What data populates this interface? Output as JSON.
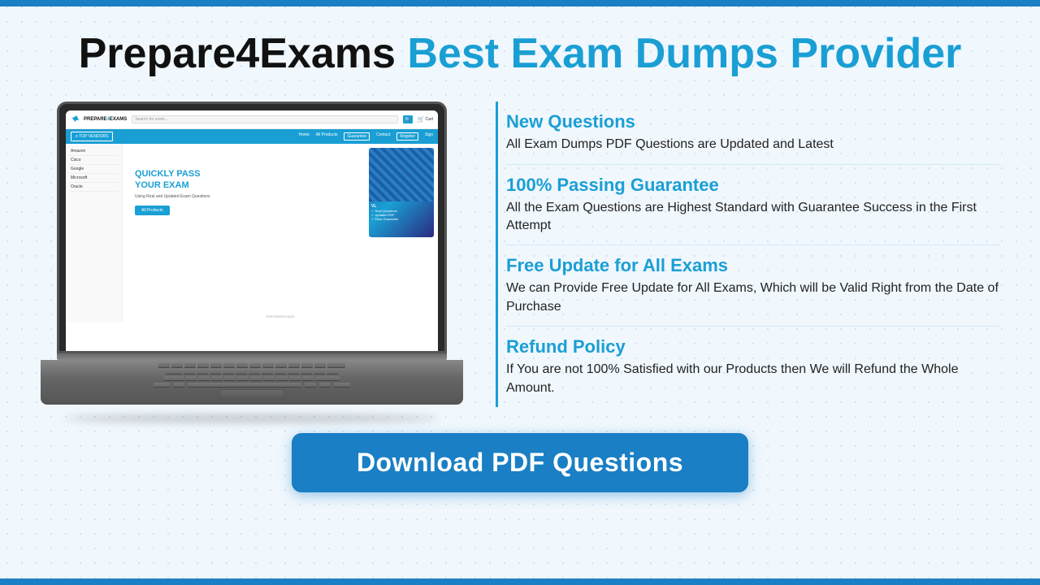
{
  "header": {
    "brand": "Prepare4Exams",
    "tagline": "Best Exam Dumps Provider"
  },
  "laptop": {
    "site": {
      "logo_text": "PREPARE",
      "logo_text2": "4EXAMS",
      "search_placeholder": "Search for exam...",
      "cart_label": "Cart",
      "nav_vendors": "≡  TOP VENDORS",
      "nav_links": [
        "Home",
        "All Products",
        "Guarantee",
        "Contact",
        "Register",
        "Sign"
      ],
      "sidebar_items": [
        "Amazon",
        "Cisco",
        "Google",
        "Microsoft",
        "Oracle"
      ],
      "hero_title": "QUICKLY PASS\nYOUR EXAM",
      "hero_subtitle": "Using Real and Updated Exam Questions",
      "hero_btn": "All Products",
      "watermark": "PREPARE4EXAMS"
    }
  },
  "features": [
    {
      "title": "New Questions",
      "description": "All Exam Dumps PDF Questions are Updated and Latest"
    },
    {
      "title": "100% Passing Guarantee",
      "description": "All the Exam Questions are Highest Standard with Guarantee Success in the First Attempt"
    },
    {
      "title": "Free Update for All Exams",
      "description": "We can Provide Free Update for All Exams, Which will be Valid Right from the Date of Purchase"
    },
    {
      "title": "Refund Policy",
      "description": "If You are not 100% Satisfied with our Products then We will Refund the Whole Amount."
    }
  ],
  "download": {
    "button_label": "Download PDF Questions"
  },
  "colors": {
    "accent": "#1a9fd4",
    "dark_blue": "#1a7fc4",
    "text_dark": "#111111"
  }
}
